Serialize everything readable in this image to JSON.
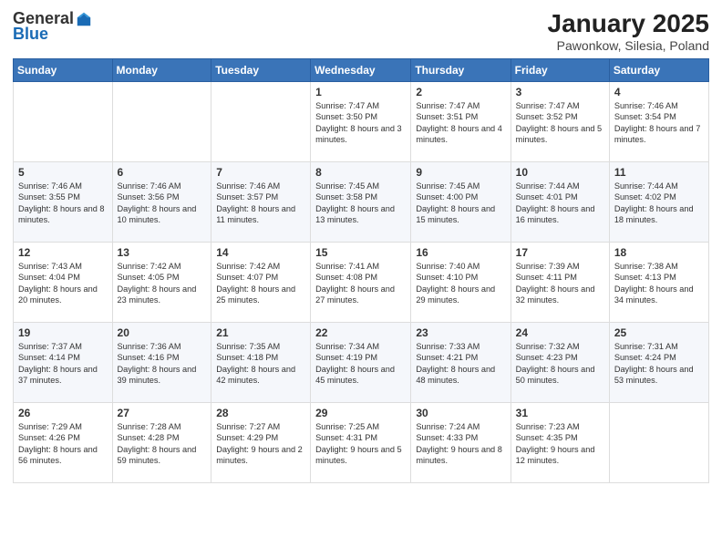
{
  "logo": {
    "general": "General",
    "blue": "Blue"
  },
  "title": "January 2025",
  "subtitle": "Pawonkow, Silesia, Poland",
  "days_header": [
    "Sunday",
    "Monday",
    "Tuesday",
    "Wednesday",
    "Thursday",
    "Friday",
    "Saturday"
  ],
  "weeks": [
    [
      {
        "day": "",
        "info": ""
      },
      {
        "day": "",
        "info": ""
      },
      {
        "day": "",
        "info": ""
      },
      {
        "day": "1",
        "info": "Sunrise: 7:47 AM\nSunset: 3:50 PM\nDaylight: 8 hours and 3 minutes."
      },
      {
        "day": "2",
        "info": "Sunrise: 7:47 AM\nSunset: 3:51 PM\nDaylight: 8 hours and 4 minutes."
      },
      {
        "day": "3",
        "info": "Sunrise: 7:47 AM\nSunset: 3:52 PM\nDaylight: 8 hours and 5 minutes."
      },
      {
        "day": "4",
        "info": "Sunrise: 7:46 AM\nSunset: 3:54 PM\nDaylight: 8 hours and 7 minutes."
      }
    ],
    [
      {
        "day": "5",
        "info": "Sunrise: 7:46 AM\nSunset: 3:55 PM\nDaylight: 8 hours and 8 minutes."
      },
      {
        "day": "6",
        "info": "Sunrise: 7:46 AM\nSunset: 3:56 PM\nDaylight: 8 hours and 10 minutes."
      },
      {
        "day": "7",
        "info": "Sunrise: 7:46 AM\nSunset: 3:57 PM\nDaylight: 8 hours and 11 minutes."
      },
      {
        "day": "8",
        "info": "Sunrise: 7:45 AM\nSunset: 3:58 PM\nDaylight: 8 hours and 13 minutes."
      },
      {
        "day": "9",
        "info": "Sunrise: 7:45 AM\nSunset: 4:00 PM\nDaylight: 8 hours and 15 minutes."
      },
      {
        "day": "10",
        "info": "Sunrise: 7:44 AM\nSunset: 4:01 PM\nDaylight: 8 hours and 16 minutes."
      },
      {
        "day": "11",
        "info": "Sunrise: 7:44 AM\nSunset: 4:02 PM\nDaylight: 8 hours and 18 minutes."
      }
    ],
    [
      {
        "day": "12",
        "info": "Sunrise: 7:43 AM\nSunset: 4:04 PM\nDaylight: 8 hours and 20 minutes."
      },
      {
        "day": "13",
        "info": "Sunrise: 7:42 AM\nSunset: 4:05 PM\nDaylight: 8 hours and 23 minutes."
      },
      {
        "day": "14",
        "info": "Sunrise: 7:42 AM\nSunset: 4:07 PM\nDaylight: 8 hours and 25 minutes."
      },
      {
        "day": "15",
        "info": "Sunrise: 7:41 AM\nSunset: 4:08 PM\nDaylight: 8 hours and 27 minutes."
      },
      {
        "day": "16",
        "info": "Sunrise: 7:40 AM\nSunset: 4:10 PM\nDaylight: 8 hours and 29 minutes."
      },
      {
        "day": "17",
        "info": "Sunrise: 7:39 AM\nSunset: 4:11 PM\nDaylight: 8 hours and 32 minutes."
      },
      {
        "day": "18",
        "info": "Sunrise: 7:38 AM\nSunset: 4:13 PM\nDaylight: 8 hours and 34 minutes."
      }
    ],
    [
      {
        "day": "19",
        "info": "Sunrise: 7:37 AM\nSunset: 4:14 PM\nDaylight: 8 hours and 37 minutes."
      },
      {
        "day": "20",
        "info": "Sunrise: 7:36 AM\nSunset: 4:16 PM\nDaylight: 8 hours and 39 minutes."
      },
      {
        "day": "21",
        "info": "Sunrise: 7:35 AM\nSunset: 4:18 PM\nDaylight: 8 hours and 42 minutes."
      },
      {
        "day": "22",
        "info": "Sunrise: 7:34 AM\nSunset: 4:19 PM\nDaylight: 8 hours and 45 minutes."
      },
      {
        "day": "23",
        "info": "Sunrise: 7:33 AM\nSunset: 4:21 PM\nDaylight: 8 hours and 48 minutes."
      },
      {
        "day": "24",
        "info": "Sunrise: 7:32 AM\nSunset: 4:23 PM\nDaylight: 8 hours and 50 minutes."
      },
      {
        "day": "25",
        "info": "Sunrise: 7:31 AM\nSunset: 4:24 PM\nDaylight: 8 hours and 53 minutes."
      }
    ],
    [
      {
        "day": "26",
        "info": "Sunrise: 7:29 AM\nSunset: 4:26 PM\nDaylight: 8 hours and 56 minutes."
      },
      {
        "day": "27",
        "info": "Sunrise: 7:28 AM\nSunset: 4:28 PM\nDaylight: 8 hours and 59 minutes."
      },
      {
        "day": "28",
        "info": "Sunrise: 7:27 AM\nSunset: 4:29 PM\nDaylight: 9 hours and 2 minutes."
      },
      {
        "day": "29",
        "info": "Sunrise: 7:25 AM\nSunset: 4:31 PM\nDaylight: 9 hours and 5 minutes."
      },
      {
        "day": "30",
        "info": "Sunrise: 7:24 AM\nSunset: 4:33 PM\nDaylight: 9 hours and 8 minutes."
      },
      {
        "day": "31",
        "info": "Sunrise: 7:23 AM\nSunset: 4:35 PM\nDaylight: 9 hours and 12 minutes."
      },
      {
        "day": "",
        "info": ""
      }
    ]
  ]
}
